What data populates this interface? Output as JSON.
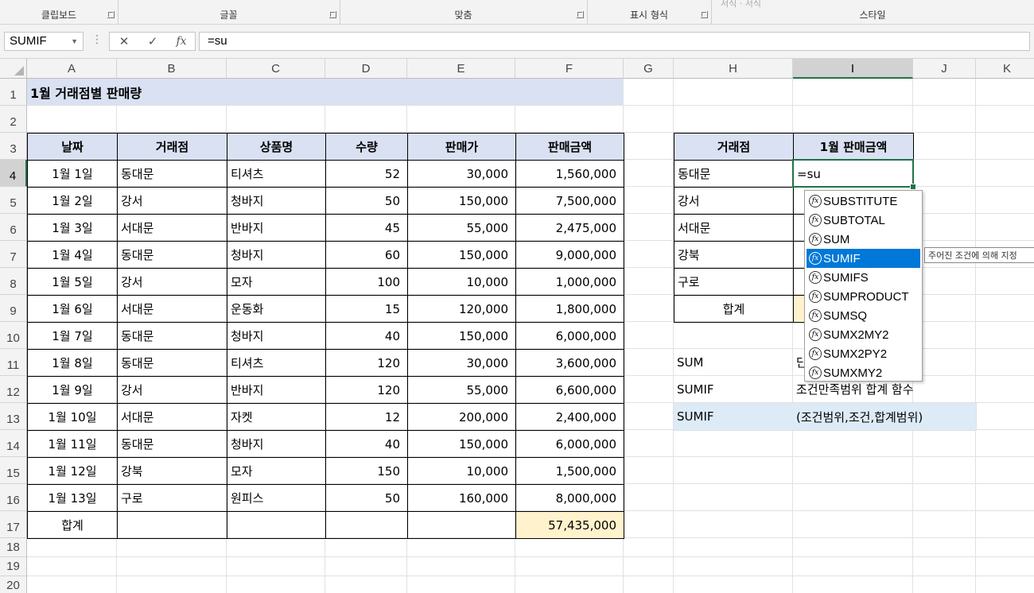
{
  "ribbon": {
    "groups": [
      "클립보드",
      "글꼴",
      "맞춤",
      "표시 형식",
      "스타일"
    ],
    "faint_text": "서식 · 서식"
  },
  "formula_bar": {
    "name_box": "SUMIF",
    "cancel_icon": "✕",
    "enter_icon": "✓",
    "fx_label": "fx",
    "formula": "=su",
    "dots": "⋮"
  },
  "columns": [
    "A",
    "B",
    "C",
    "D",
    "E",
    "F",
    "G",
    "H",
    "I",
    "J",
    "K"
  ],
  "rows": [
    "1",
    "2",
    "3",
    "4",
    "5",
    "6",
    "7",
    "8",
    "9",
    "10",
    "11",
    "12",
    "13",
    "14",
    "15",
    "16",
    "17",
    "18",
    "19",
    "20"
  ],
  "sheet": {
    "title": "1월 거래점별 판매량",
    "headers": [
      "날짜",
      "거래점",
      "상품명",
      "수량",
      "판매가",
      "판매금액"
    ],
    "data": [
      [
        "1월 1일",
        "동대문",
        "티셔츠",
        "52",
        "30,000",
        "1,560,000"
      ],
      [
        "1월 2일",
        "강서",
        "청바지",
        "50",
        "150,000",
        "7,500,000"
      ],
      [
        "1월 3일",
        "서대문",
        "반바지",
        "45",
        "55,000",
        "2,475,000"
      ],
      [
        "1월 4일",
        "동대문",
        "청바지",
        "60",
        "150,000",
        "9,000,000"
      ],
      [
        "1월 5일",
        "강서",
        "모자",
        "100",
        "10,000",
        "1,000,000"
      ],
      [
        "1월 6일",
        "서대문",
        "운동화",
        "15",
        "120,000",
        "1,800,000"
      ],
      [
        "1월 7일",
        "동대문",
        "청바지",
        "40",
        "150,000",
        "6,000,000"
      ],
      [
        "1월 8일",
        "동대문",
        "티셔츠",
        "120",
        "30,000",
        "3,600,000"
      ],
      [
        "1월 9일",
        "강서",
        "반바지",
        "120",
        "55,000",
        "6,600,000"
      ],
      [
        "1월 10일",
        "서대문",
        "자켓",
        "12",
        "200,000",
        "2,400,000"
      ],
      [
        "1월 11일",
        "동대문",
        "청바지",
        "40",
        "150,000",
        "6,000,000"
      ],
      [
        "1월 12일",
        "강북",
        "모자",
        "150",
        "10,000",
        "1,500,000"
      ],
      [
        "1월 13일",
        "구로",
        "원피스",
        "50",
        "160,000",
        "8,000,000"
      ]
    ],
    "total_label": "합계",
    "total_value": "57,435,000"
  },
  "summary": {
    "headers": [
      "거래점",
      "1월 판매금액"
    ],
    "branches": [
      "동대문",
      "강서",
      "서대문",
      "강북",
      "구로"
    ],
    "total_label": "합계",
    "editing_value": "=su"
  },
  "notes": [
    {
      "name": "SUM",
      "desc": "단"
    },
    {
      "name": "SUMIF",
      "desc": "조건만족범위 합계 함수"
    },
    {
      "name": "SUMIF",
      "desc": "(조건범위,조건,합계범위)"
    }
  ],
  "autocomplete": {
    "items": [
      "SUBSTITUTE",
      "SUBTOTAL",
      "SUM",
      "SUMIF",
      "SUMIFS",
      "SUMPRODUCT",
      "SUMSQ",
      "SUMX2MY2",
      "SUMX2PY2",
      "SUMXMY2"
    ],
    "selected": "SUMIF",
    "tooltip": "주어진 조건에 의해 지정"
  },
  "colors": {
    "header_fill": "#d9e1f2",
    "total_fill": "#fff2cc",
    "note_fill": "#ddebf7",
    "selection": "#217346",
    "ac_highlight": "#0078d7"
  }
}
